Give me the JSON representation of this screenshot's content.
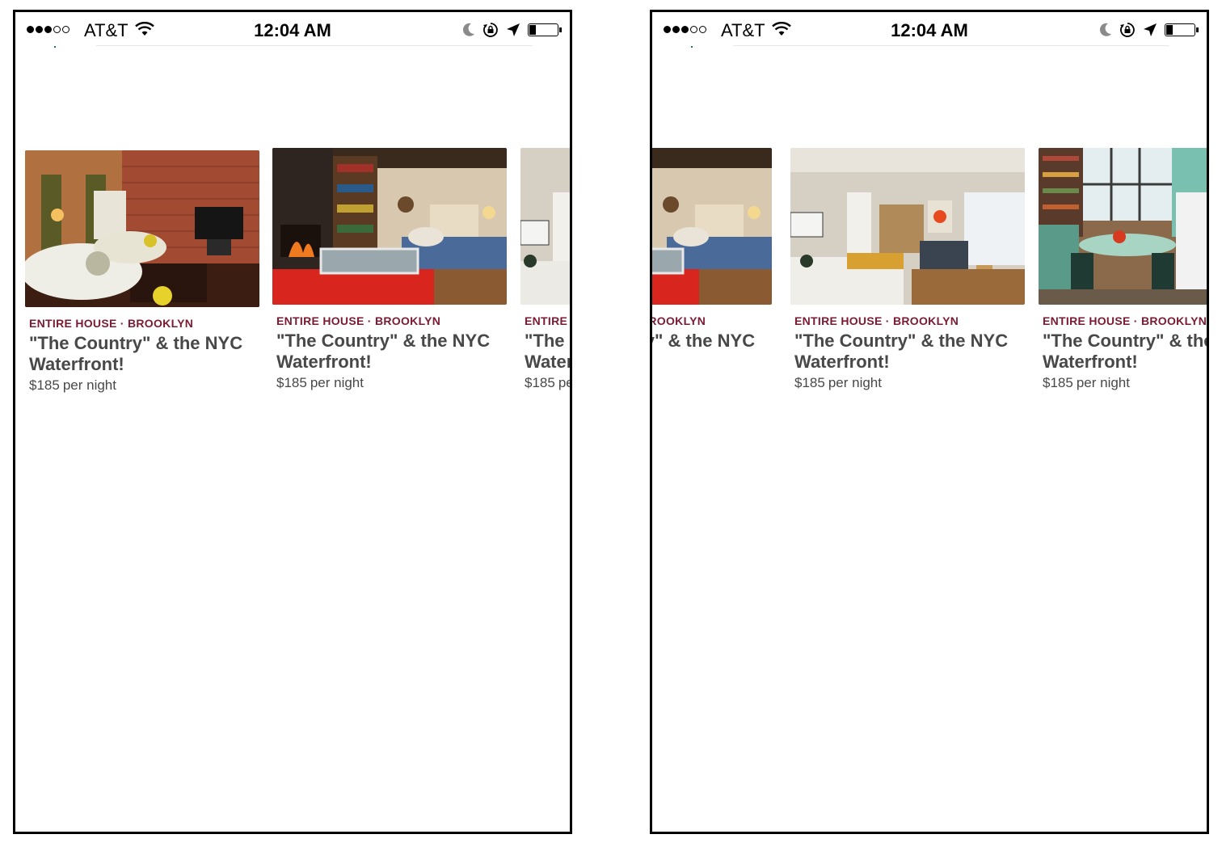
{
  "status_bar": {
    "carrier": "AT&T",
    "time": "12:04 AM",
    "signal_bars_filled": 3,
    "signal_bars_total": 5,
    "icons": [
      "wifi-icon",
      "moon-icon",
      "rotation-lock-icon",
      "location-arrow-icon",
      "battery-icon"
    ],
    "battery_level": 0.2
  },
  "listings": [
    {
      "kicker": "ENTIRE HOUSE · BROOKLYN",
      "title": "\"The Country\" & the NYC Waterfront!",
      "price": "$185",
      "price_unit": "per night",
      "photo": "living room with brick wall and white sofas"
    },
    {
      "kicker": "ENTIRE HOUSE · BROOKLYN",
      "title": "\"The Country\" & the NYC Waterfront!",
      "price": "$185",
      "price_unit": "per night",
      "photo": "living room with fireplace, bookshelves and red rug"
    },
    {
      "kicker": "ENTIRE HOUSE · BROOKLYN",
      "title": "\"The Country\" & the NYC Waterfront!",
      "price": "$185",
      "price_unit": "per night",
      "photo": "bright studio with bed, kitchen and sofa"
    },
    {
      "kicker": "ENTIRE HOUSE · BROOKLYN",
      "title": "\"The Country\" & the NYC Waterfront!",
      "price": "$185",
      "price_unit": "per night",
      "photo": "kitchen with teal dining table and chairs"
    }
  ],
  "colors": {
    "kicker": "#7a1a33",
    "text": "#484848",
    "frame": "#000000"
  }
}
